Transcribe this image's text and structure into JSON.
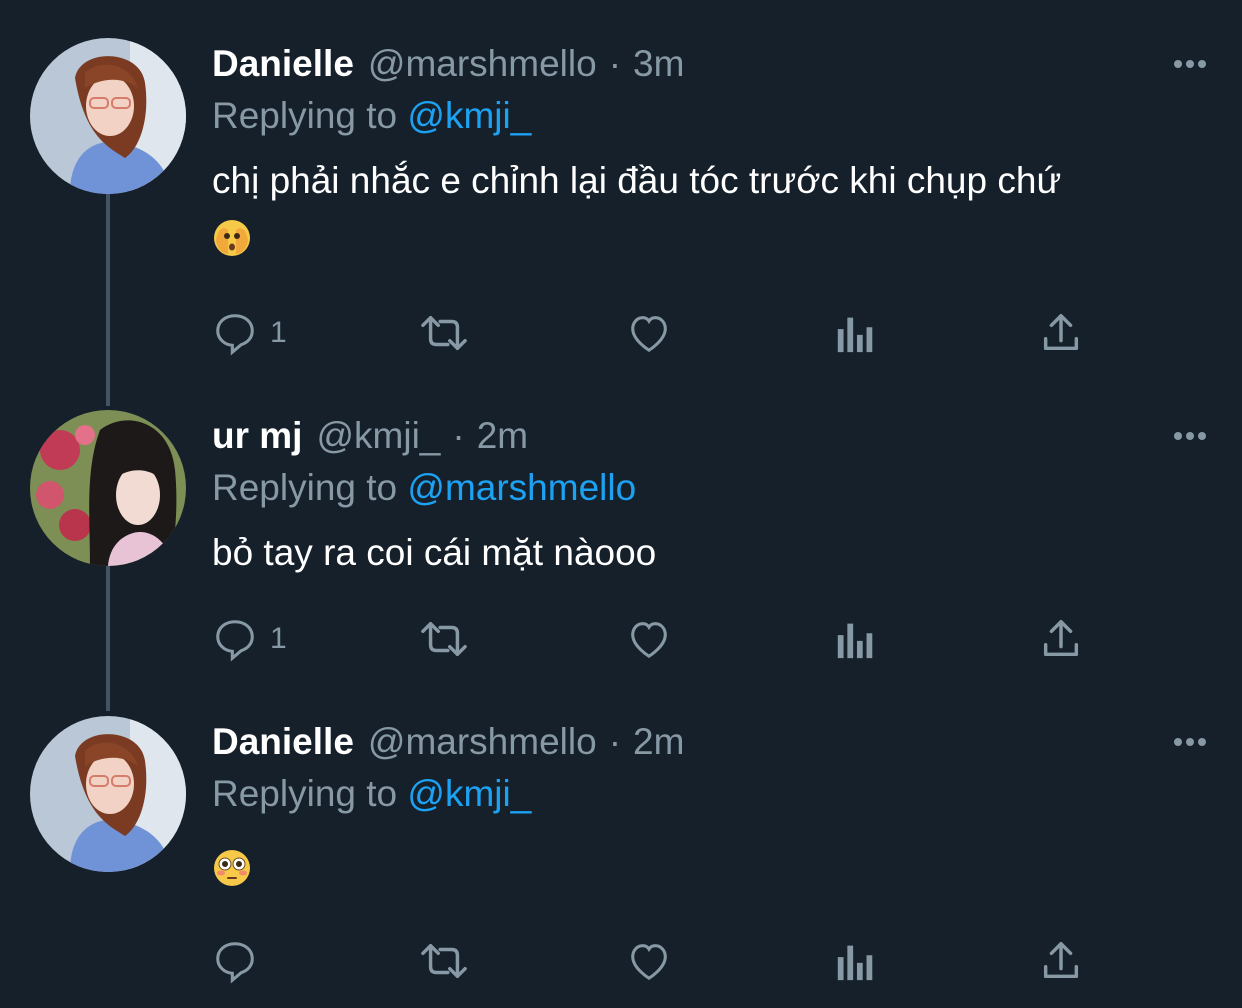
{
  "tweets": [
    {
      "name": "Danielle",
      "handle": "@marshmello",
      "separator": "·",
      "time": "3m",
      "replying_prefix": "Replying to",
      "replying_to": "@kmji_",
      "text": "chị phải nhắc e chỉnh lại đầu tóc trước khi chụp chứ",
      "emoji": "face-peeking-through-hands",
      "reply_count": "1",
      "avatar": "danielle-avatar"
    },
    {
      "name": "ur mj",
      "handle": "@kmji_",
      "separator": "·",
      "time": "2m",
      "replying_prefix": "Replying to",
      "replying_to": "@marshmello",
      "text": "bỏ tay ra coi cái mặt nàooo",
      "reply_count": "1",
      "avatar": "kmji-avatar"
    },
    {
      "name": "Danielle",
      "handle": "@marshmello",
      "separator": "·",
      "time": "2m",
      "replying_prefix": "Replying to",
      "replying_to": "@kmji_",
      "text": "",
      "emoji": "flushed-face",
      "reply_count": "",
      "avatar": "danielle-avatar"
    }
  ],
  "icons": {
    "reply": "reply-icon",
    "retweet": "retweet-icon",
    "like": "like-icon",
    "analytics": "analytics-icon",
    "share": "share-icon",
    "more": "more-icon"
  },
  "colors": {
    "background": "#15202b",
    "text": "#ffffff",
    "secondary": "#8899a6",
    "accent": "#1da1f2",
    "thread": "#425364"
  }
}
